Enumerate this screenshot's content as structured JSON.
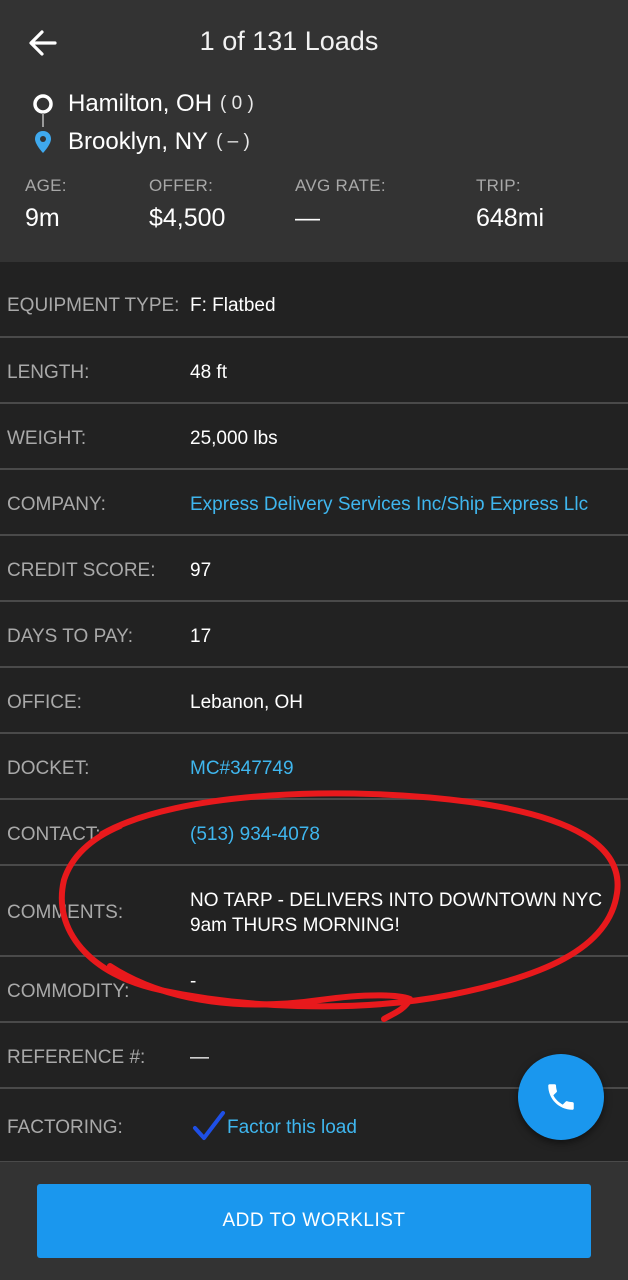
{
  "header": {
    "title": "1 of 131 Loads",
    "origin": {
      "city": "Hamilton, OH",
      "count": "( 0 )"
    },
    "destination": {
      "city": "Brooklyn, NY",
      "count": "( – )"
    },
    "stats": [
      {
        "label": "AGE:",
        "value": "9m"
      },
      {
        "label": "OFFER:",
        "value": "$4,500"
      },
      {
        "label": "AVG RATE:",
        "value": "—"
      },
      {
        "label": "TRIP:",
        "value": "648mi"
      }
    ]
  },
  "details": {
    "equipment_type": {
      "label": "EQUIPMENT TYPE:",
      "value": "F: Flatbed"
    },
    "length": {
      "label": "LENGTH:",
      "value": "48 ft"
    },
    "weight": {
      "label": "WEIGHT:",
      "value": "25,000 lbs"
    },
    "company": {
      "label": "COMPANY:",
      "value": "Express Delivery Services Inc/Ship Express Llc"
    },
    "credit_score": {
      "label": "CREDIT SCORE:",
      "value": "97"
    },
    "days_to_pay": {
      "label": "DAYS TO PAY:",
      "value": "17"
    },
    "office": {
      "label": "OFFICE:",
      "value": "Lebanon, OH"
    },
    "docket": {
      "label": "DOCKET:",
      "value": "MC#347749"
    },
    "contact": {
      "label": "CONTACT:",
      "value": "(513) 934-4078"
    },
    "comments": {
      "label": "COMMENTS:",
      "value": "NO TARP - DELIVERS INTO DOWNTOWN NYC 9am THURS MORNING!"
    },
    "commodity": {
      "label": "COMMODITY:",
      "value": "-"
    },
    "reference": {
      "label": "REFERENCE #:",
      "value": "—"
    },
    "factoring": {
      "label": "FACTORING:",
      "value": "Factor this load"
    }
  },
  "footer": {
    "add_to_worklist_label": "ADD TO WORKLIST"
  },
  "colors": {
    "accent": "#1a97ee",
    "link": "#3fb6ee",
    "annotation": "#e8191c",
    "check": "#1e4fe6"
  },
  "icons": {
    "back": "arrow-left-icon",
    "origin": "origin-circle-icon",
    "destination": "location-pin-icon",
    "factoring": "checkmark-icon",
    "call": "phone-icon"
  }
}
